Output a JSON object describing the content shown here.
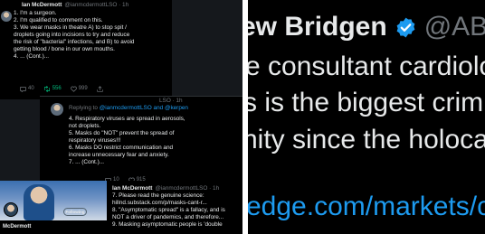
{
  "colors": {
    "tweet_bg": "#000000",
    "text": "#e7e9ea",
    "muted": "#71767b",
    "link": "#1d9bf0",
    "retweet_active": "#00ba7c",
    "verified": "#1d9bf0"
  },
  "tweet1": {
    "name": "Ian McDermott",
    "handle": "@ianmcdermottLSO · 1h",
    "lines": [
      "1. I'm a surgeon.",
      "2. I'm qualified to comment on this.",
      "3. We wear masks in theatre A) to stop spit /",
      "droplets going into incisions to try and reduce",
      "the risk of \"bacterial\" infections, and B) to avoid",
      "getting blood / bone in our own mouths.",
      "4. ... (Cont.)..."
    ],
    "actions": {
      "replies": "40",
      "retweets": "556",
      "likes": "999"
    }
  },
  "tweet2": {
    "handle_fragment": "LSO · 1h",
    "reply_prefix": "Replying to ",
    "reply_links": "@ianmcdermottLSO and @kerpen",
    "lines": [
      "4. Respiratory viruses are spread in aerosols,",
      "not droplets.",
      "5. Masks do \"NOT\" prevent the spread of",
      "respiratory viruses!!!",
      "6. Masks DO restrict communication and",
      "increase unnecessary fear and anxiety.",
      "7. ... (Cont.)..."
    ],
    "actions": {
      "replies": "10",
      "likes": "915"
    }
  },
  "tweet3": {
    "name": "Ian McDermott",
    "handle": "@ianmcdermottLSO · 1h",
    "lines": [
      "7. Please read the genuine science:",
      "hillnd.substack.com/p/masks-cant-r...",
      "8. \"Asymptomatic spread\" is a fallacy, and is",
      "NOT a driver of pandemics, and therefore...",
      "9. Masking asymptomatic people is 'double"
    ]
  },
  "profile": {
    "follow_label": "Following",
    "name": "McDermott"
  },
  "zoom": {
    "name": "ew Bridgen",
    "handle": "@ABri",
    "line1": "e consultant cardiolo",
    "line2": "s is the biggest crim",
    "line3": "nity since the holoca",
    "link": "edge.com/markets/c"
  }
}
